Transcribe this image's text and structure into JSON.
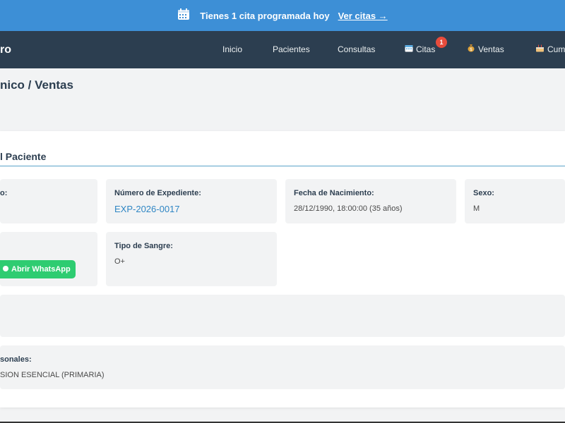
{
  "banner": {
    "icon": "calendar-icon",
    "message": "Tienes 1 cita programada hoy",
    "link_label": "Ver citas →"
  },
  "navbar": {
    "brand": "ro",
    "items": [
      {
        "label": "Inicio"
      },
      {
        "label": "Pacientes"
      },
      {
        "label": "Consultas"
      },
      {
        "label": "Citas",
        "icon": "calendar-icon",
        "badge": "1"
      },
      {
        "label": "Ventas",
        "icon": "money-bag-icon"
      },
      {
        "label": "Cum",
        "icon": "birthday-cake-icon"
      }
    ]
  },
  "page": {
    "title": "nico / Ventas"
  },
  "patient_card": {
    "title": "l Paciente",
    "fields": {
      "first_label": "o:",
      "expediente": {
        "label": "Número de Expediente:",
        "value": "EXP-2026-0017"
      },
      "nacimiento": {
        "label": "Fecha de Nacimiento:",
        "value": "28/12/1990, 18:00:00 (35 años)"
      },
      "sexo": {
        "label": "Sexo:",
        "value": "M"
      },
      "sangre": {
        "label": "Tipo de Sangre:",
        "value": "O+"
      },
      "personales": {
        "label": "sonales:",
        "value": "SION ESENCIAL (PRIMARIA)"
      }
    },
    "whatsapp_label": "Abrir WhatsApp"
  },
  "colors": {
    "banner": "#3d8fd6",
    "navbar": "#2c3e50",
    "badge": "#e74c3c",
    "whatsapp": "#2ecc71",
    "link": "#2f86c4"
  }
}
